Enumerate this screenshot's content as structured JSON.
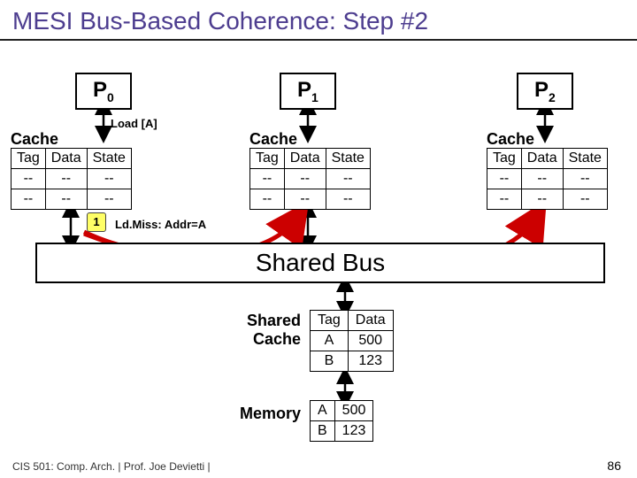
{
  "title": "MESI Bus-Based Coherence: Step #2",
  "processors": {
    "p0": {
      "label": "P",
      "sub": "0"
    },
    "p1": {
      "label": "P",
      "sub": "1"
    },
    "p2": {
      "label": "P",
      "sub": "2"
    }
  },
  "load_label": "Load [A]",
  "ldmiss_label": "Ld.Miss: Addr=A",
  "step_badge": "1",
  "cache_label": "Cache",
  "cache_headers": {
    "tag": "Tag",
    "data": "Data",
    "state": "State"
  },
  "cache_rows": {
    "r0": {
      "tag": "--",
      "data": "--",
      "state": "--"
    },
    "r1": {
      "tag": "--",
      "data": "--",
      "state": "--"
    }
  },
  "shared_bus": "Shared Bus",
  "shared_cache_label_l1": "Shared",
  "shared_cache_label_l2": "Cache",
  "shared_cache": {
    "headers": {
      "tag": "Tag",
      "data": "Data"
    },
    "rows": {
      "r0": {
        "tag": "A",
        "data": "500"
      },
      "r1": {
        "tag": "B",
        "data": "123"
      }
    }
  },
  "memory_label": "Memory",
  "memory": {
    "rows": {
      "r0": {
        "tag": "A",
        "data": "500"
      },
      "r1": {
        "tag": "B",
        "data": "123"
      }
    }
  },
  "footer": "CIS 501: Comp. Arch. | Prof. Joe Devietti | ",
  "pagenum": "86"
}
